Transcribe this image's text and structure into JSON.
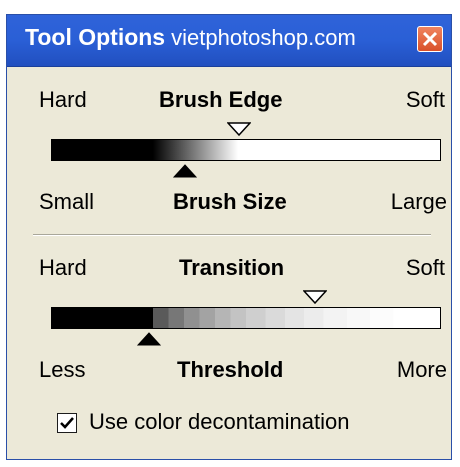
{
  "window": {
    "title": "Tool Options",
    "watermark": "vietphotoshop.com",
    "close_icon": "close-icon",
    "accent_color": "#2a5fd6"
  },
  "brush_edge": {
    "left_label": "Hard",
    "center_label": "Brush Edge",
    "right_label": "Soft",
    "edge_fraction": 0.47
  },
  "brush_size": {
    "left_label": "Small",
    "center_label": "Brush Size",
    "right_label": "Large",
    "size_fraction": 0.35
  },
  "transition": {
    "left_label": "Hard",
    "center_label": "Transition",
    "right_label": "Soft",
    "transition_fraction": 0.67
  },
  "threshold": {
    "left_label": "Less",
    "center_label": "Threshold",
    "right_label": "More",
    "threshold_fraction": 0.25
  },
  "decontamination": {
    "label": "Use color decontamination",
    "checked": true
  }
}
